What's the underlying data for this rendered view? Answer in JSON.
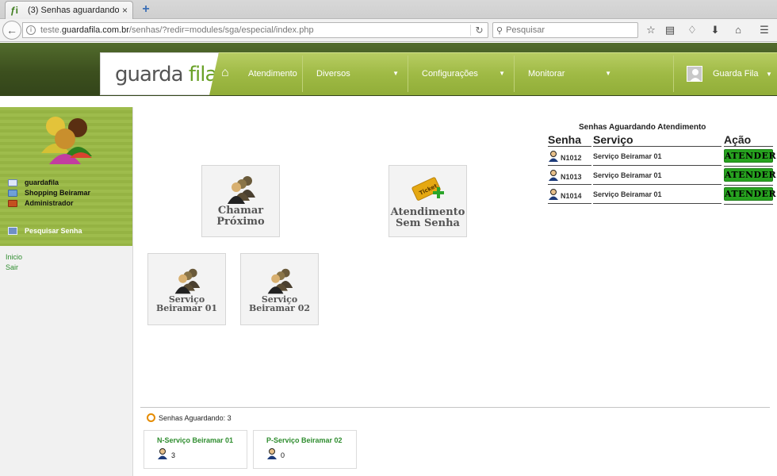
{
  "browser": {
    "tab_title": "(3) Senhas aguardando ...",
    "tab_close": "×",
    "new_tab": "+",
    "url_prefix": "teste.",
    "url_host": "guardafila.com.br",
    "url_path": "/senhas/?redir=modules/sga/especial/index.php",
    "search_placeholder": "Pesquisar"
  },
  "header": {
    "logo_part1": "guarda",
    "logo_part2": "fila",
    "menu": [
      "Atendimento",
      "Diversos",
      "Configurações",
      "Monitorar"
    ],
    "user_name": "Guarda Fila"
  },
  "sidebar": {
    "info": [
      "guardafila",
      "Shopping Beiramar",
      "Administrador"
    ],
    "search_label": "Pesquisar Senha",
    "links": [
      "Inicio",
      "Sair"
    ]
  },
  "actions": {
    "call_next": [
      "Chamar",
      "Próximo"
    ],
    "no_ticket": [
      "Atendimento",
      "Sem Senha"
    ],
    "ticket_label": "Ticket",
    "service1": [
      "Serviço",
      "Beiramar 01"
    ],
    "service2": [
      "Serviço",
      "Beiramar 02"
    ]
  },
  "queue": {
    "title": "Senhas Aguardando Atendimento",
    "headers": [
      "Senha",
      "Serviço",
      "Ação"
    ],
    "rows": [
      {
        "ticket": "N1012",
        "service": "Serviço Beiramar 01",
        "action": "ATENDER"
      },
      {
        "ticket": "N1013",
        "service": "Serviço Beiramar 01",
        "action": "ATENDER"
      },
      {
        "ticket": "N1014",
        "service": "Serviço Beiramar 01",
        "action": "ATENDER"
      }
    ]
  },
  "footer": {
    "waiting_label": "Senhas Aguardando: 3",
    "services": [
      {
        "name": "N-Serviço Beiramar 01",
        "count": "3"
      },
      {
        "name": "P-Serviço Beiramar 02",
        "count": "0"
      }
    ]
  },
  "colors": {
    "header_dark": "#3c4f1e",
    "menu_green": "#9fba45",
    "atender_green": "#27a21f",
    "link_green": "#2f8d2f"
  }
}
